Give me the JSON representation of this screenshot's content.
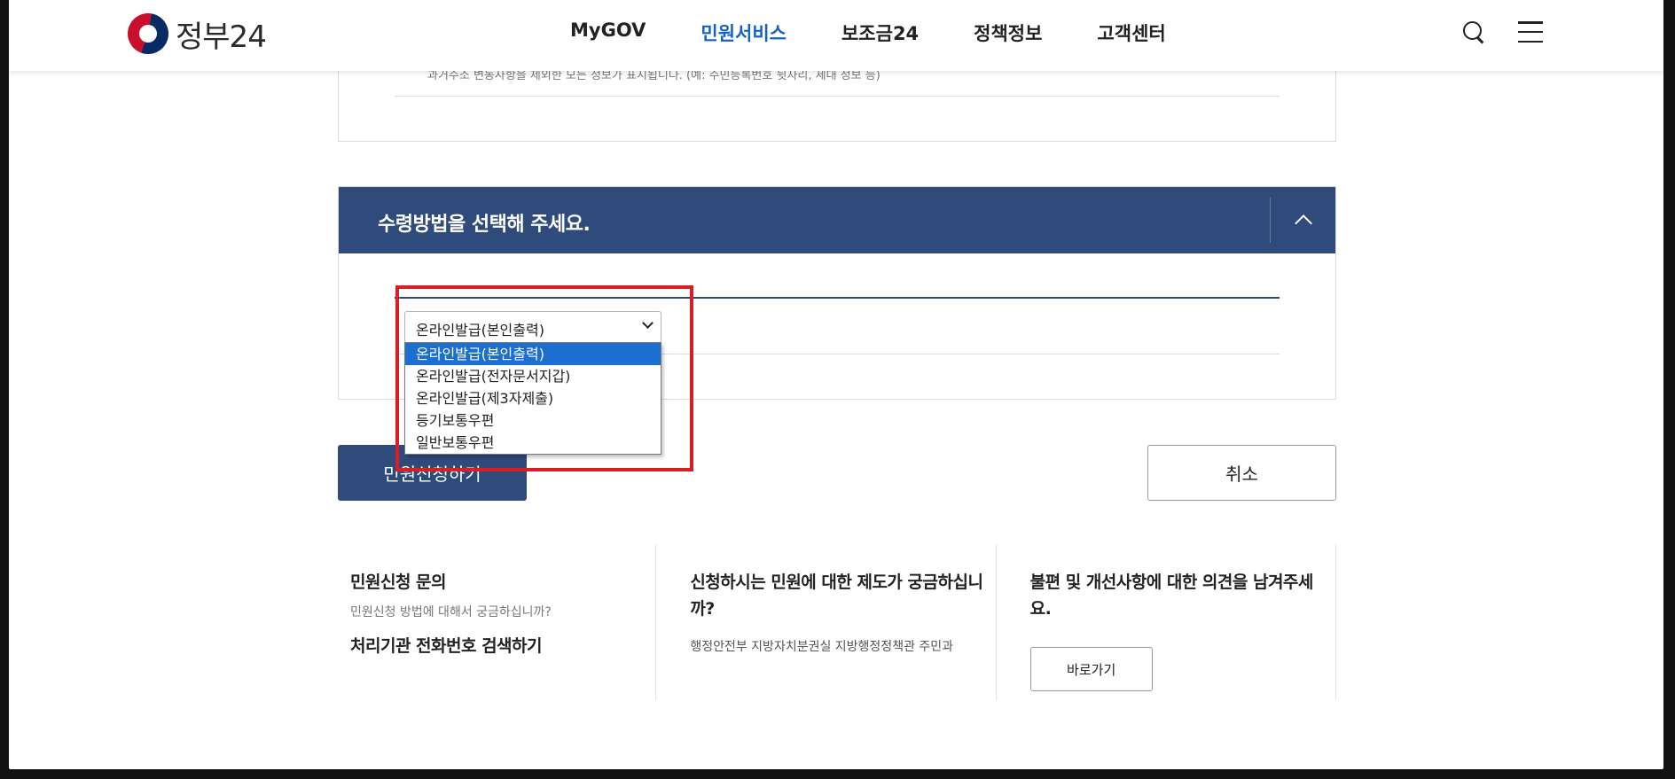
{
  "header": {
    "logo_text": "정부24",
    "nav": [
      "MyGOV",
      "민원서비스",
      "보조금24",
      "정책정보",
      "고객센터"
    ],
    "active_nav": "민원서비스"
  },
  "top_box": {
    "text": "과거주소 변동사항을 제외한 모든 정보가 표시됩니다. (예: 주민등록번호 뒷자리, 세대 정보 등)"
  },
  "section": {
    "title": "수령방법을 선택해 주세요.",
    "select_value": "온라인발급(본인출력)",
    "options": [
      "온라인발급(본인출력)",
      "온라인발급(전자문서지갑)",
      "온라인발급(제3자제출)",
      "등기보통우편",
      "일반보통우편"
    ],
    "selected_index": 0
  },
  "buttons": {
    "apply": "민원신청하기",
    "cancel": "취소"
  },
  "info": {
    "col1": {
      "title": "민원신청 문의",
      "sub": "민원신청 방법에 대해서 궁금하십니까?",
      "link": "처리기관 전화번호 검색하기"
    },
    "col2": {
      "title": "신청하시는 민원에 대한 제도가 궁금하십니까?",
      "desc": "행정안전부 지방자치분권실 지방행정정책관 주민과"
    },
    "col3": {
      "title": "불편 및 개선사항에 대한 의견을 남겨주세요.",
      "button": "바로가기"
    }
  },
  "colors": {
    "primary": "#2f4b7c",
    "nav_active": "#1565c0",
    "option_selected": "#1a6fd1",
    "highlight": "#d81f26"
  }
}
